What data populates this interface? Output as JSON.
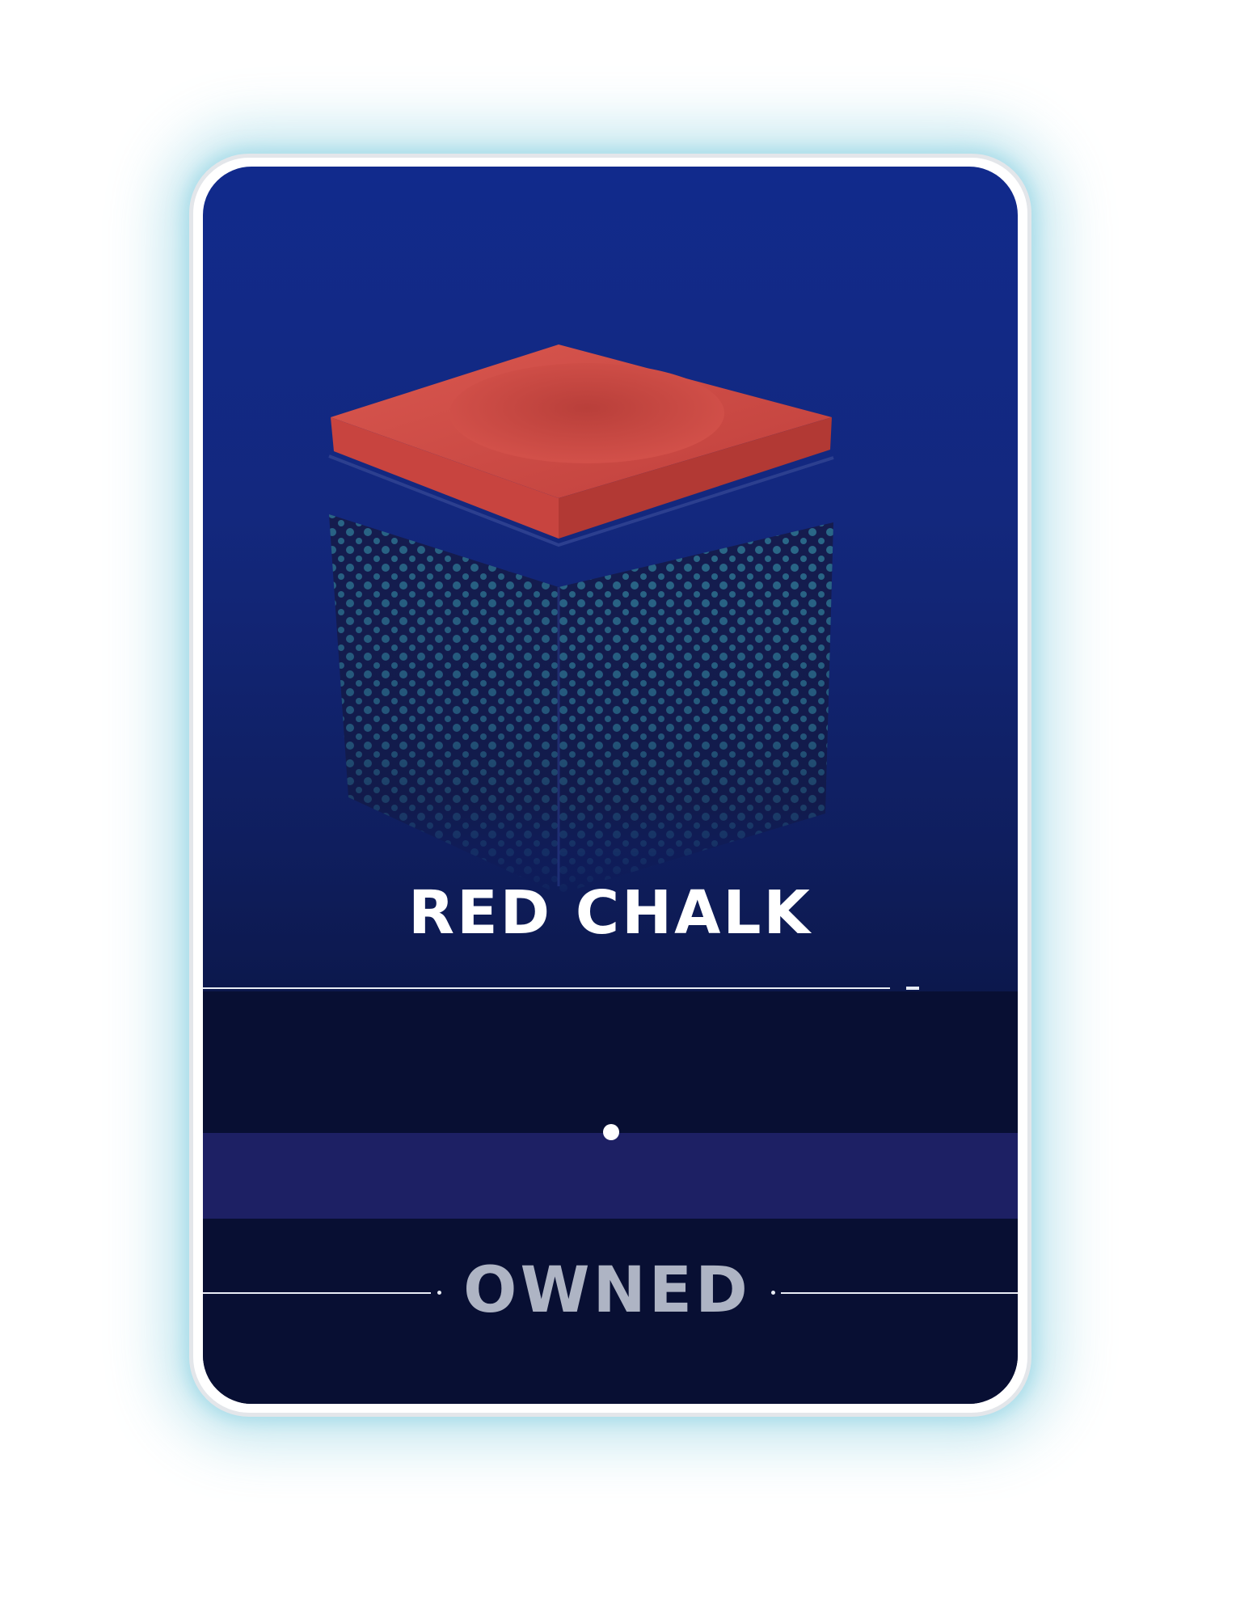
{
  "card": {
    "item_name": "RED CHALK",
    "item_icon": "red-chalk-cube",
    "status": "OWNED",
    "progress": 0.5,
    "colors": {
      "frame": "#e3e6ea",
      "glow": "#8fd3e2",
      "card_top": "#112a8c",
      "card_bottom": "#070d2e",
      "chalk_red": "#cf4a45",
      "pattern_dots": "#3a9fb3",
      "status_text": "#aeb4c4"
    }
  }
}
